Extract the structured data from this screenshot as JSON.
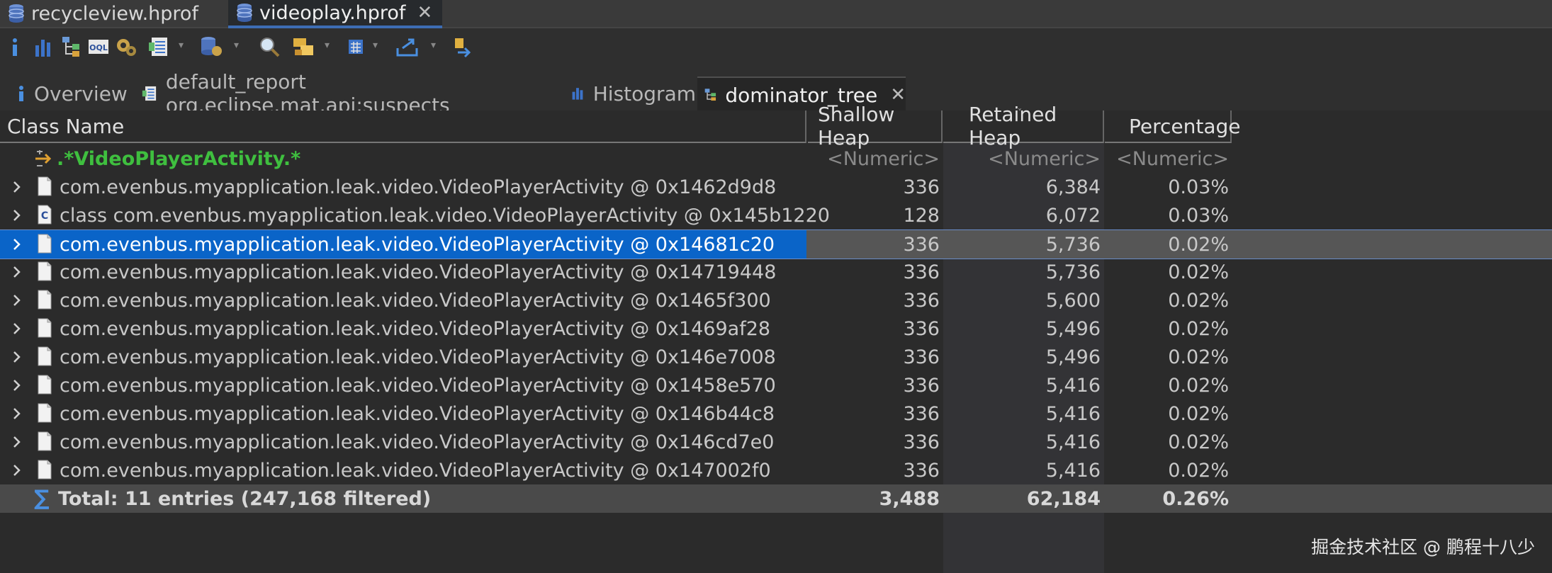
{
  "editor_tabs": [
    {
      "label": "recycleview.hprof",
      "active": false
    },
    {
      "label": "videoplay.hprof",
      "active": true
    }
  ],
  "view_tabs": [
    {
      "label": "Overview",
      "icon": "info-icon"
    },
    {
      "label": "default_report org.eclipse.mat.api:suspects",
      "icon": "report-icon"
    },
    {
      "label": "Histogram",
      "icon": "histogram-icon"
    },
    {
      "label": "dominator_tree",
      "icon": "tree-icon",
      "active": true
    }
  ],
  "columns": [
    "Class Name",
    "Shallow Heap",
    "Retained Heap",
    "Percentage"
  ],
  "filter_row": {
    "name": ".*VideoPlayerActivity.*",
    "shallow": "<Numeric>",
    "retained": "<Numeric>",
    "percentage": "<Numeric>"
  },
  "rows": [
    {
      "name": "com.evenbus.myapplication.leak.video.VideoPlayerActivity @ 0x1462d9d8",
      "shallow": "336",
      "retained": "6,384",
      "percentage": "0.03%",
      "icon": "object-icon"
    },
    {
      "name": "class com.evenbus.myapplication.leak.video.VideoPlayerActivity @ 0x145b1220",
      "shallow": "128",
      "retained": "6,072",
      "percentage": "0.03%",
      "icon": "class-icon"
    },
    {
      "name": "com.evenbus.myapplication.leak.video.VideoPlayerActivity @ 0x14681c20",
      "shallow": "336",
      "retained": "5,736",
      "percentage": "0.02%",
      "icon": "object-icon",
      "selected": true
    },
    {
      "name": "com.evenbus.myapplication.leak.video.VideoPlayerActivity @ 0x14719448",
      "shallow": "336",
      "retained": "5,736",
      "percentage": "0.02%",
      "icon": "object-icon"
    },
    {
      "name": "com.evenbus.myapplication.leak.video.VideoPlayerActivity @ 0x1465f300",
      "shallow": "336",
      "retained": "5,600",
      "percentage": "0.02%",
      "icon": "object-icon"
    },
    {
      "name": "com.evenbus.myapplication.leak.video.VideoPlayerActivity @ 0x1469af28",
      "shallow": "336",
      "retained": "5,496",
      "percentage": "0.02%",
      "icon": "object-icon"
    },
    {
      "name": "com.evenbus.myapplication.leak.video.VideoPlayerActivity @ 0x146e7008",
      "shallow": "336",
      "retained": "5,496",
      "percentage": "0.02%",
      "icon": "object-icon"
    },
    {
      "name": "com.evenbus.myapplication.leak.video.VideoPlayerActivity @ 0x1458e570",
      "shallow": "336",
      "retained": "5,416",
      "percentage": "0.02%",
      "icon": "object-icon"
    },
    {
      "name": "com.evenbus.myapplication.leak.video.VideoPlayerActivity @ 0x146b44c8",
      "shallow": "336",
      "retained": "5,416",
      "percentage": "0.02%",
      "icon": "object-icon"
    },
    {
      "name": "com.evenbus.myapplication.leak.video.VideoPlayerActivity @ 0x146cd7e0",
      "shallow": "336",
      "retained": "5,416",
      "percentage": "0.02%",
      "icon": "object-icon"
    },
    {
      "name": "com.evenbus.myapplication.leak.video.VideoPlayerActivity @ 0x147002f0",
      "shallow": "336",
      "retained": "5,416",
      "percentage": "0.02%",
      "icon": "object-icon"
    }
  ],
  "total_row": {
    "name": "Total: 11 entries (247,168 filtered)",
    "shallow": "3,488",
    "retained": "62,184",
    "percentage": "0.26%"
  },
  "watermark": "掘金技术社区 @ 鹏程十八少",
  "colors": {
    "selection": "#0a64c8",
    "filter_regex": "#3fbf3f",
    "active_tab_accent": "#3d6db4"
  }
}
